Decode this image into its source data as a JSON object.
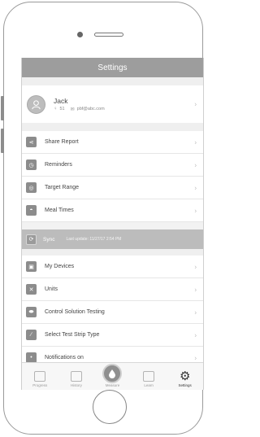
{
  "header": {
    "title": "Settings"
  },
  "profile": {
    "name": "Jack",
    "age": "51",
    "email": "pbf@abc.com"
  },
  "menu_group_1": [
    {
      "label": "Share Report",
      "icon": "share-icon"
    },
    {
      "label": "Reminders",
      "icon": "alarm-icon"
    },
    {
      "label": "Target Range",
      "icon": "target-icon"
    },
    {
      "label": "Meal Times",
      "icon": "meal-icon"
    }
  ],
  "sync": {
    "label": "Sync",
    "last_update": "Last update: 11/27/17 2:54 PM"
  },
  "menu_group_2": [
    {
      "label": "My Devices",
      "icon": "device-icon"
    },
    {
      "label": "Units",
      "icon": "units-icon"
    },
    {
      "label": "Control Solution Testing",
      "icon": "control-solution-icon"
    },
    {
      "label": "Select Test Strip Type",
      "icon": "test-strip-icon"
    },
    {
      "label": "Notifications on",
      "icon": "notifications-icon"
    }
  ],
  "tabs": [
    {
      "label": "Progress",
      "icon": "progress-icon"
    },
    {
      "label": "History",
      "icon": "history-icon"
    },
    {
      "label": "Measure",
      "icon": "drop-icon"
    },
    {
      "label": "Learn",
      "icon": "learn-icon"
    },
    {
      "label": "Settings",
      "icon": "gear-icon"
    }
  ]
}
